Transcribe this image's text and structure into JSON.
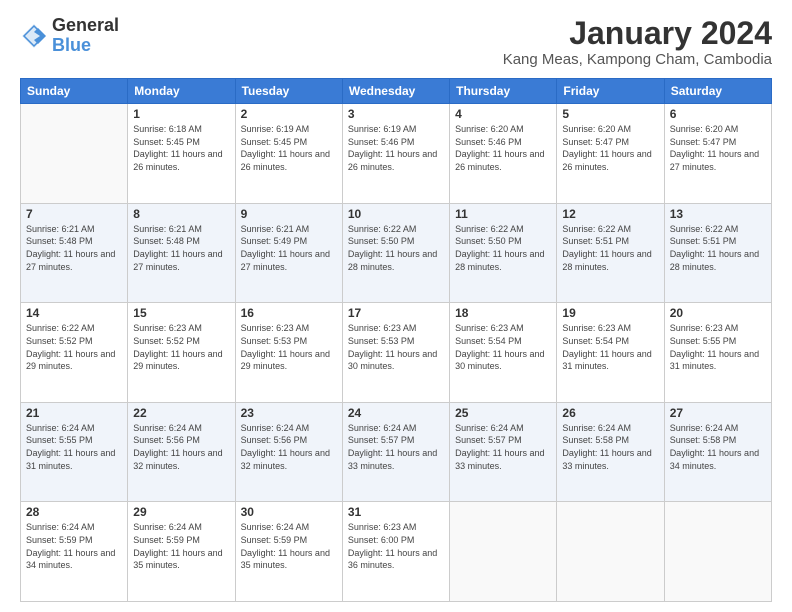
{
  "logo": {
    "general": "General",
    "blue": "Blue"
  },
  "title": "January 2024",
  "location": "Kang Meas, Kampong Cham, Cambodia",
  "days_header": [
    "Sunday",
    "Monday",
    "Tuesday",
    "Wednesday",
    "Thursday",
    "Friday",
    "Saturday"
  ],
  "weeks": [
    [
      {
        "num": "",
        "sunrise": "",
        "sunset": "",
        "daylight": ""
      },
      {
        "num": "1",
        "sunrise": "Sunrise: 6:18 AM",
        "sunset": "Sunset: 5:45 PM",
        "daylight": "Daylight: 11 hours and 26 minutes."
      },
      {
        "num": "2",
        "sunrise": "Sunrise: 6:19 AM",
        "sunset": "Sunset: 5:45 PM",
        "daylight": "Daylight: 11 hours and 26 minutes."
      },
      {
        "num": "3",
        "sunrise": "Sunrise: 6:19 AM",
        "sunset": "Sunset: 5:46 PM",
        "daylight": "Daylight: 11 hours and 26 minutes."
      },
      {
        "num": "4",
        "sunrise": "Sunrise: 6:20 AM",
        "sunset": "Sunset: 5:46 PM",
        "daylight": "Daylight: 11 hours and 26 minutes."
      },
      {
        "num": "5",
        "sunrise": "Sunrise: 6:20 AM",
        "sunset": "Sunset: 5:47 PM",
        "daylight": "Daylight: 11 hours and 26 minutes."
      },
      {
        "num": "6",
        "sunrise": "Sunrise: 6:20 AM",
        "sunset": "Sunset: 5:47 PM",
        "daylight": "Daylight: 11 hours and 27 minutes."
      }
    ],
    [
      {
        "num": "7",
        "sunrise": "Sunrise: 6:21 AM",
        "sunset": "Sunset: 5:48 PM",
        "daylight": "Daylight: 11 hours and 27 minutes."
      },
      {
        "num": "8",
        "sunrise": "Sunrise: 6:21 AM",
        "sunset": "Sunset: 5:48 PM",
        "daylight": "Daylight: 11 hours and 27 minutes."
      },
      {
        "num": "9",
        "sunrise": "Sunrise: 6:21 AM",
        "sunset": "Sunset: 5:49 PM",
        "daylight": "Daylight: 11 hours and 27 minutes."
      },
      {
        "num": "10",
        "sunrise": "Sunrise: 6:22 AM",
        "sunset": "Sunset: 5:50 PM",
        "daylight": "Daylight: 11 hours and 28 minutes."
      },
      {
        "num": "11",
        "sunrise": "Sunrise: 6:22 AM",
        "sunset": "Sunset: 5:50 PM",
        "daylight": "Daylight: 11 hours and 28 minutes."
      },
      {
        "num": "12",
        "sunrise": "Sunrise: 6:22 AM",
        "sunset": "Sunset: 5:51 PM",
        "daylight": "Daylight: 11 hours and 28 minutes."
      },
      {
        "num": "13",
        "sunrise": "Sunrise: 6:22 AM",
        "sunset": "Sunset: 5:51 PM",
        "daylight": "Daylight: 11 hours and 28 minutes."
      }
    ],
    [
      {
        "num": "14",
        "sunrise": "Sunrise: 6:22 AM",
        "sunset": "Sunset: 5:52 PM",
        "daylight": "Daylight: 11 hours and 29 minutes."
      },
      {
        "num": "15",
        "sunrise": "Sunrise: 6:23 AM",
        "sunset": "Sunset: 5:52 PM",
        "daylight": "Daylight: 11 hours and 29 minutes."
      },
      {
        "num": "16",
        "sunrise": "Sunrise: 6:23 AM",
        "sunset": "Sunset: 5:53 PM",
        "daylight": "Daylight: 11 hours and 29 minutes."
      },
      {
        "num": "17",
        "sunrise": "Sunrise: 6:23 AM",
        "sunset": "Sunset: 5:53 PM",
        "daylight": "Daylight: 11 hours and 30 minutes."
      },
      {
        "num": "18",
        "sunrise": "Sunrise: 6:23 AM",
        "sunset": "Sunset: 5:54 PM",
        "daylight": "Daylight: 11 hours and 30 minutes."
      },
      {
        "num": "19",
        "sunrise": "Sunrise: 6:23 AM",
        "sunset": "Sunset: 5:54 PM",
        "daylight": "Daylight: 11 hours and 31 minutes."
      },
      {
        "num": "20",
        "sunrise": "Sunrise: 6:23 AM",
        "sunset": "Sunset: 5:55 PM",
        "daylight": "Daylight: 11 hours and 31 minutes."
      }
    ],
    [
      {
        "num": "21",
        "sunrise": "Sunrise: 6:24 AM",
        "sunset": "Sunset: 5:55 PM",
        "daylight": "Daylight: 11 hours and 31 minutes."
      },
      {
        "num": "22",
        "sunrise": "Sunrise: 6:24 AM",
        "sunset": "Sunset: 5:56 PM",
        "daylight": "Daylight: 11 hours and 32 minutes."
      },
      {
        "num": "23",
        "sunrise": "Sunrise: 6:24 AM",
        "sunset": "Sunset: 5:56 PM",
        "daylight": "Daylight: 11 hours and 32 minutes."
      },
      {
        "num": "24",
        "sunrise": "Sunrise: 6:24 AM",
        "sunset": "Sunset: 5:57 PM",
        "daylight": "Daylight: 11 hours and 33 minutes."
      },
      {
        "num": "25",
        "sunrise": "Sunrise: 6:24 AM",
        "sunset": "Sunset: 5:57 PM",
        "daylight": "Daylight: 11 hours and 33 minutes."
      },
      {
        "num": "26",
        "sunrise": "Sunrise: 6:24 AM",
        "sunset": "Sunset: 5:58 PM",
        "daylight": "Daylight: 11 hours and 33 minutes."
      },
      {
        "num": "27",
        "sunrise": "Sunrise: 6:24 AM",
        "sunset": "Sunset: 5:58 PM",
        "daylight": "Daylight: 11 hours and 34 minutes."
      }
    ],
    [
      {
        "num": "28",
        "sunrise": "Sunrise: 6:24 AM",
        "sunset": "Sunset: 5:59 PM",
        "daylight": "Daylight: 11 hours and 34 minutes."
      },
      {
        "num": "29",
        "sunrise": "Sunrise: 6:24 AM",
        "sunset": "Sunset: 5:59 PM",
        "daylight": "Daylight: 11 hours and 35 minutes."
      },
      {
        "num": "30",
        "sunrise": "Sunrise: 6:24 AM",
        "sunset": "Sunset: 5:59 PM",
        "daylight": "Daylight: 11 hours and 35 minutes."
      },
      {
        "num": "31",
        "sunrise": "Sunrise: 6:23 AM",
        "sunset": "Sunset: 6:00 PM",
        "daylight": "Daylight: 11 hours and 36 minutes."
      },
      {
        "num": "",
        "sunrise": "",
        "sunset": "",
        "daylight": ""
      },
      {
        "num": "",
        "sunrise": "",
        "sunset": "",
        "daylight": ""
      },
      {
        "num": "",
        "sunrise": "",
        "sunset": "",
        "daylight": ""
      }
    ]
  ]
}
